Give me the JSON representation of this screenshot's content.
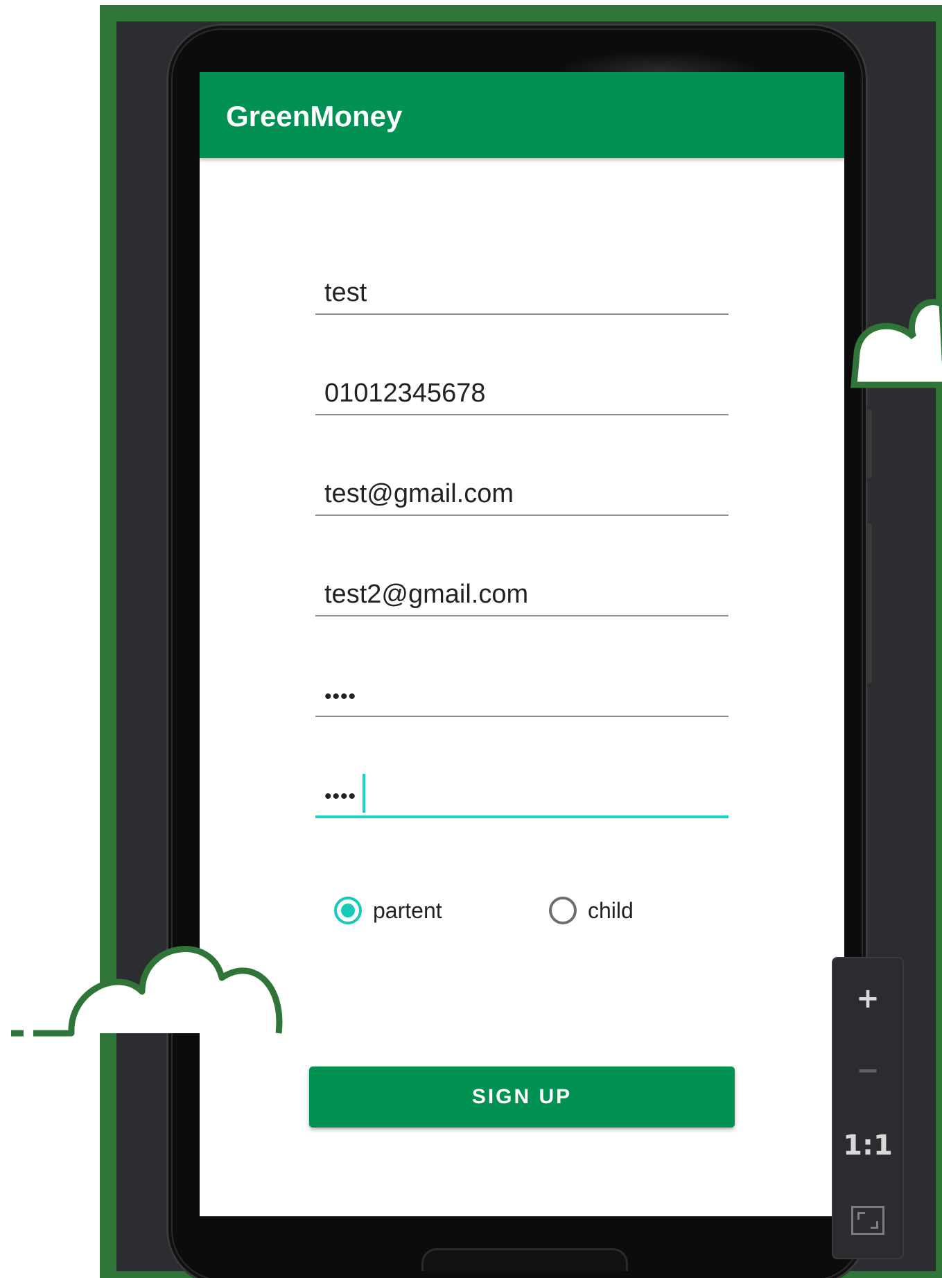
{
  "app": {
    "title": "GreenMoney"
  },
  "form": {
    "fields": [
      {
        "value": "test"
      },
      {
        "value": "01012345678"
      },
      {
        "value": "test@gmail.com"
      },
      {
        "value": "test2@gmail.com"
      },
      {
        "value": "••••"
      },
      {
        "value": "••••"
      }
    ],
    "role_options": [
      {
        "label": "partent",
        "selected": true
      },
      {
        "label": "child",
        "selected": false
      }
    ],
    "submit_label": "SIGN UP"
  },
  "zoom_toolbar": {
    "zoom_in": "+",
    "zoom_out": "−",
    "actual_size": "1:1",
    "fit_icon": "fit-screen-icon"
  },
  "colors": {
    "brand_green": "#009153",
    "accent_teal": "#17d6c7",
    "frame_green": "#2f7537"
  }
}
